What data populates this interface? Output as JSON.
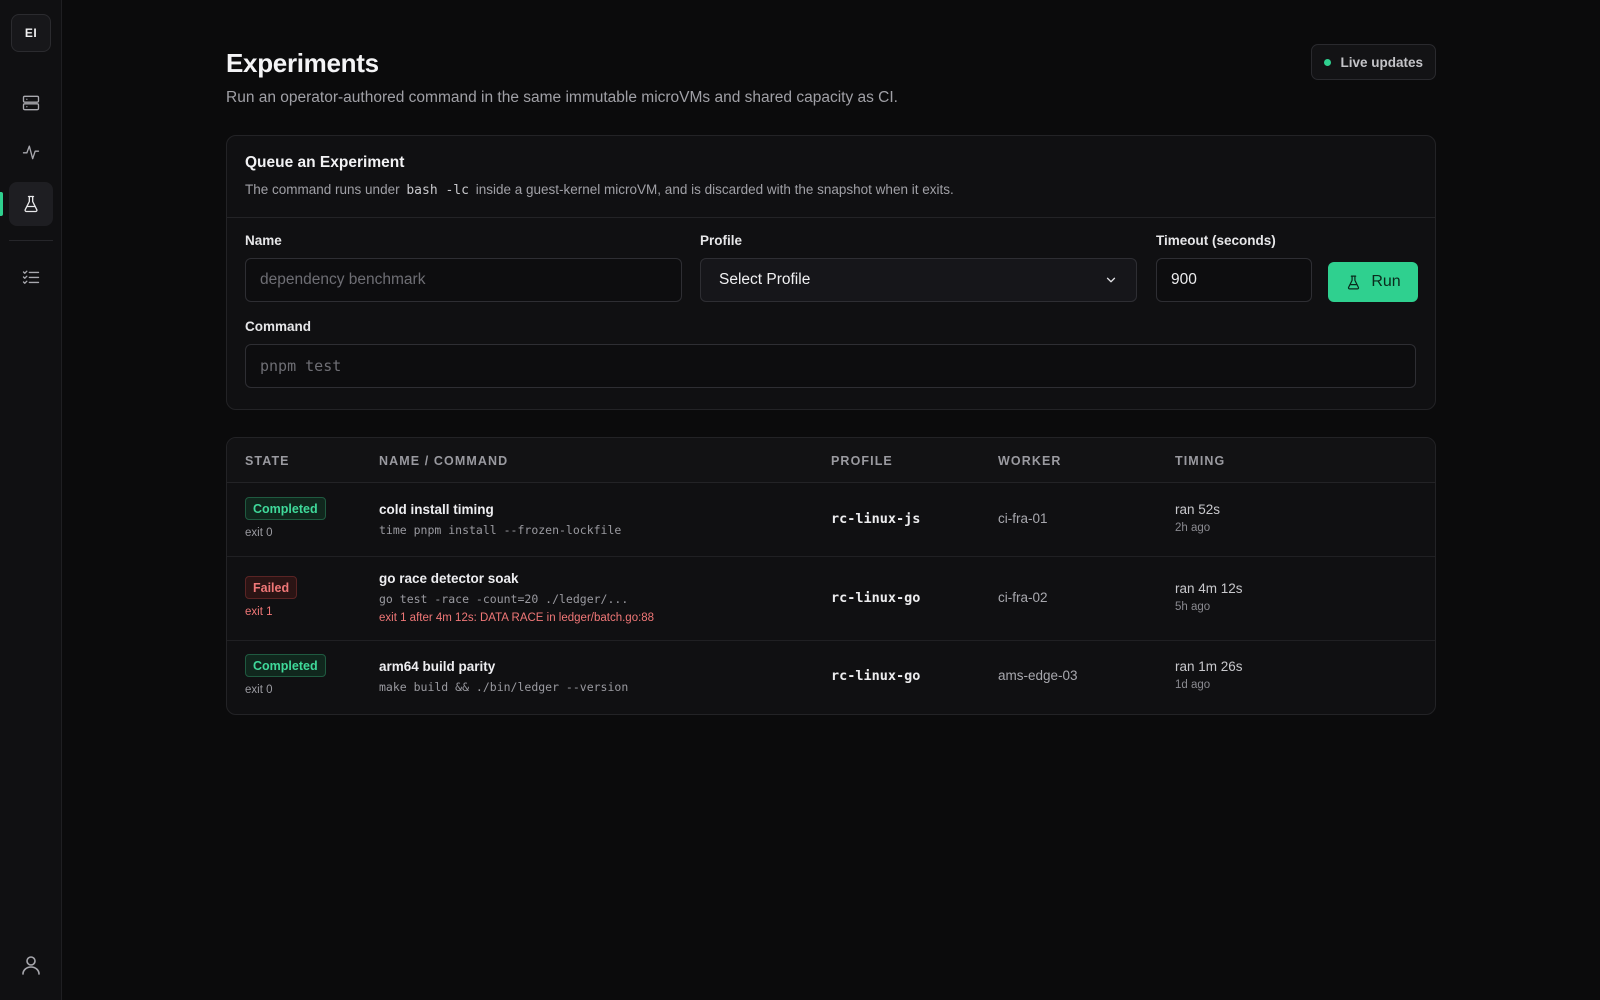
{
  "app": {
    "logo_text": "EI"
  },
  "sidebar": {
    "items": [
      {
        "icon": "server-icon",
        "label": "Servers"
      },
      {
        "icon": "activity-icon",
        "label": "Activity"
      },
      {
        "icon": "flask-icon",
        "label": "Experiments",
        "active": true
      },
      {
        "icon": "checklist-icon",
        "label": "Tasks"
      }
    ],
    "user_icon": "user-icon"
  },
  "header": {
    "title": "Experiments",
    "subtitle": "Run an operator-authored command in the same immutable microVMs and shared capacity as CI.",
    "live_label": "Live updates"
  },
  "form": {
    "title": "Queue an Experiment",
    "desc_pre": "The command runs under",
    "desc_code": "bash -lc",
    "desc_post": "inside a guest-kernel microVM, and is discarded with the snapshot when it exits.",
    "name_label": "Name",
    "name_placeholder": "dependency benchmark",
    "profile_label": "Profile",
    "profile_value": "Select Profile",
    "timeout_label": "Timeout (seconds)",
    "timeout_value": "900",
    "run_label": "Run",
    "command_label": "Command",
    "command_placeholder": "pnpm test"
  },
  "table": {
    "columns": [
      "STATE",
      "NAME / COMMAND",
      "PROFILE",
      "WORKER",
      "TIMING"
    ],
    "rows": [
      {
        "state": "Completed",
        "status": "ok",
        "exit": "exit 0",
        "name": "cold install timing",
        "command": "time pnpm install --frozen-lockfile",
        "error": "",
        "profile": "rc-linux-js",
        "worker": "ci-fra-01",
        "ran": "ran 52s",
        "ago": "2h ago"
      },
      {
        "state": "Failed",
        "status": "fail",
        "exit": "exit 1",
        "name": "go race detector soak",
        "command": "go test -race -count=20 ./ledger/...",
        "error": "exit 1 after 4m 12s: DATA RACE in ledger/batch.go:88",
        "profile": "rc-linux-go",
        "worker": "ci-fra-02",
        "ran": "ran 4m 12s",
        "ago": "5h ago"
      },
      {
        "state": "Completed",
        "status": "ok",
        "exit": "exit 0",
        "name": "arm64 build parity",
        "command": "make build && ./bin/ledger --version",
        "error": "",
        "profile": "rc-linux-go",
        "worker": "ams-edge-03",
        "ran": "ran 1m 26s",
        "ago": "1d ago"
      }
    ]
  },
  "colors": {
    "accent": "#2fd08f",
    "danger": "#f07777",
    "background": "#0b0b0c"
  }
}
